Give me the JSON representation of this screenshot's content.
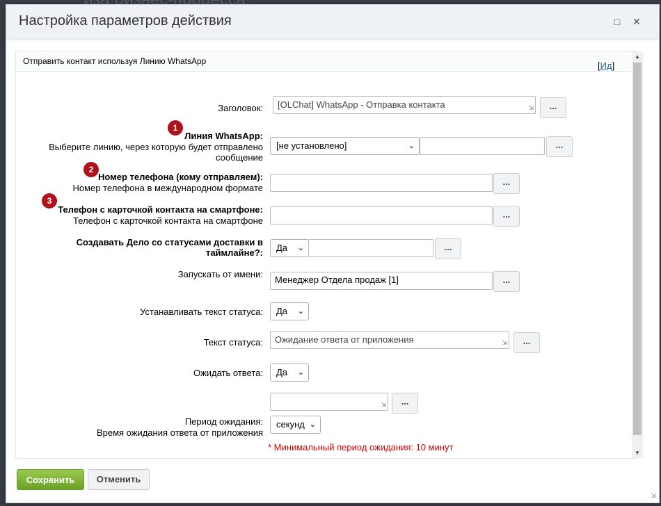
{
  "background_title": "иза бизнес-процесса",
  "dialog": {
    "title": "Настройка параметров действия",
    "minimize_icon": "square-icon",
    "close_icon": "close-icon"
  },
  "activity": {
    "name": "Отправить контакт используя Линию WhatsApp",
    "id_link_prefix": "[",
    "id_link": "Ид",
    "id_link_suffix": "]"
  },
  "fields": {
    "title": {
      "label": "Заголовок:",
      "value": "[OLChat] WhatsApp - Отправка контакта"
    },
    "line": {
      "label": "Линия WhatsApp:",
      "description": "Выберите линию, через которую будет отправлено сообщение",
      "selected": "[не установлено]",
      "badge": "1"
    },
    "phone": {
      "label": "Номер телефона (кому отправляем):",
      "description": "Номер телефона в международном формате",
      "badge": "2"
    },
    "contact_phone": {
      "label": "Телефон с карточкой контакта на смартфоне:",
      "description": "Телефон с карточкой контакта на смартфоне",
      "badge": "3"
    },
    "create_task": {
      "label": "Создавать Дело со статусами доставки в таймлайне?:",
      "selected": "Да"
    },
    "run_as": {
      "label": "Запускать от имени:",
      "value": "Менеджер Отдела продаж [1]"
    },
    "set_status": {
      "label": "Устанавливать текст статуса:",
      "selected": "Да"
    },
    "status_text": {
      "label": "Текст статуса:",
      "value": "Ожидание ответа от приложения"
    },
    "wait_reply": {
      "label": "Ожидать ответа:",
      "selected": "Да"
    },
    "wait_period": {
      "label": "Период ожидания:",
      "description": "Время ожидания ответа от приложения",
      "unit": "секунд"
    }
  },
  "dots_label": "...",
  "note": "* Минимальный период ожидания: 10 минут",
  "buttons": {
    "save": "Сохранить",
    "cancel": "Отменить"
  },
  "colors": {
    "badge": "#b0121b",
    "save": "#7cb32f",
    "note": "#d40000",
    "link": "#2067b0"
  }
}
